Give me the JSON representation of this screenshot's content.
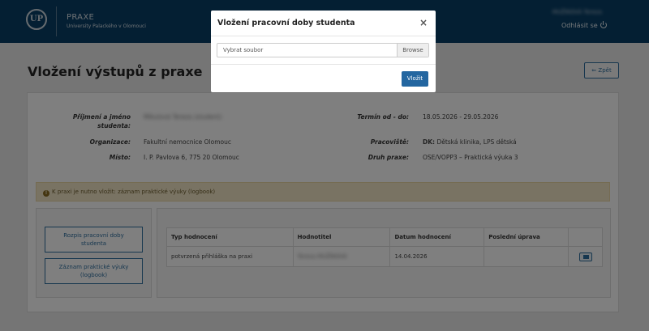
{
  "header": {
    "brand_title": "PRAXE",
    "brand_subtitle": "University Palackého v Olomouci",
    "logo_text": "UP",
    "user_name": "MUŽÍKOVÁ Tereza",
    "logout_label": "Odhlásit se"
  },
  "page": {
    "title": "Vložení výstupů z praxe",
    "back_label": "Zpět"
  },
  "info": {
    "name_label": "Příjmení a jméno studenta:",
    "name_value": "Mikulová Tereza (student)",
    "term_label": "Termín od - do:",
    "term_value": "18.05.2026 - 29.05.2026",
    "org_label": "Organizace:",
    "org_value": "Fakultní nemocnice Olomouc",
    "workplace_label": "Pracoviště:",
    "workplace_bold": "DK:",
    "workplace_value": "Dětská klinika, LPS dětská",
    "place_label": "Místo:",
    "place_value": "I. P. Pavlova 6, 775 20 Olomouc",
    "type_label": "Druh praxe:",
    "type_value": "OSE/VOPP3 – Praktická výuka 3"
  },
  "alert": {
    "text": "K praxi je nutno vložit: záznam praktické výuky (logbook)"
  },
  "side": {
    "btn1": "Rozpis pracovní doby studenta",
    "btn2": "Záznam praktické výuky (logbook)"
  },
  "table": {
    "headers": [
      "Typ hodnocení",
      "Hodnotitel",
      "Datum hodnocení",
      "Poslední úprava",
      ""
    ],
    "rows": [
      [
        "potvrzená přihláška na praxi",
        "Tereza MUŽÍKOVÁ",
        "14.04.2026",
        ""
      ]
    ]
  },
  "modal": {
    "title": "Vložení pracovní doby studenta",
    "close": "×",
    "file_placeholder": "Vybrat soubor",
    "browse_label": "Browse",
    "submit_label": "Vložit"
  }
}
